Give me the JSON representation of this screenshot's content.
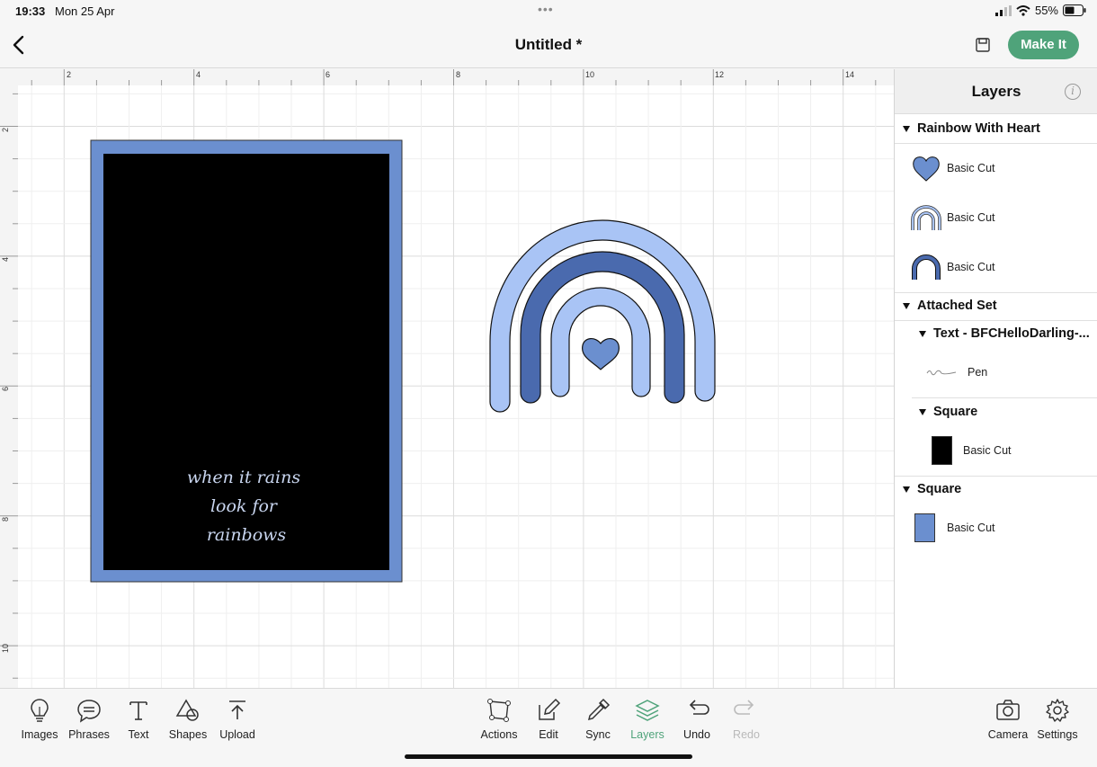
{
  "status": {
    "time": "19:33",
    "date": "Mon 25 Apr",
    "battery": "55%"
  },
  "header": {
    "title": "Untitled *",
    "make_it": "Make It"
  },
  "ruler": {
    "top_ticks": [
      "2",
      "4",
      "6",
      "8",
      "10",
      "12",
      "14"
    ],
    "left_ticks": [
      "2",
      "4",
      "6",
      "8",
      "10"
    ]
  },
  "design": {
    "card_text": "when it rains look for rainbows"
  },
  "layers": {
    "title": "Layers",
    "groups": [
      {
        "name": "Rainbow With Heart",
        "items": [
          "Basic Cut",
          "Basic Cut",
          "Basic Cut"
        ]
      },
      {
        "name": "Attached Set",
        "subgroups": [
          {
            "name": "Text - BFCHelloDarling-...",
            "items": [
              "Pen"
            ]
          },
          {
            "name": "Square",
            "items": [
              "Basic Cut"
            ]
          }
        ]
      },
      {
        "name": "Square",
        "items": [
          "Basic Cut"
        ]
      }
    ]
  },
  "toolbar": {
    "left": [
      "Images",
      "Phrases",
      "Text",
      "Shapes",
      "Upload"
    ],
    "center": [
      "Actions",
      "Edit",
      "Sync",
      "Layers",
      "Undo",
      "Redo"
    ],
    "right": [
      "Camera",
      "Settings"
    ]
  },
  "colors": {
    "accent": "#4fa37a",
    "card_blue": "#6b8fcf",
    "rainbow_light": "#a9c4f5",
    "rainbow_dark": "#4a6aae",
    "heart": "#6b8fcf"
  }
}
